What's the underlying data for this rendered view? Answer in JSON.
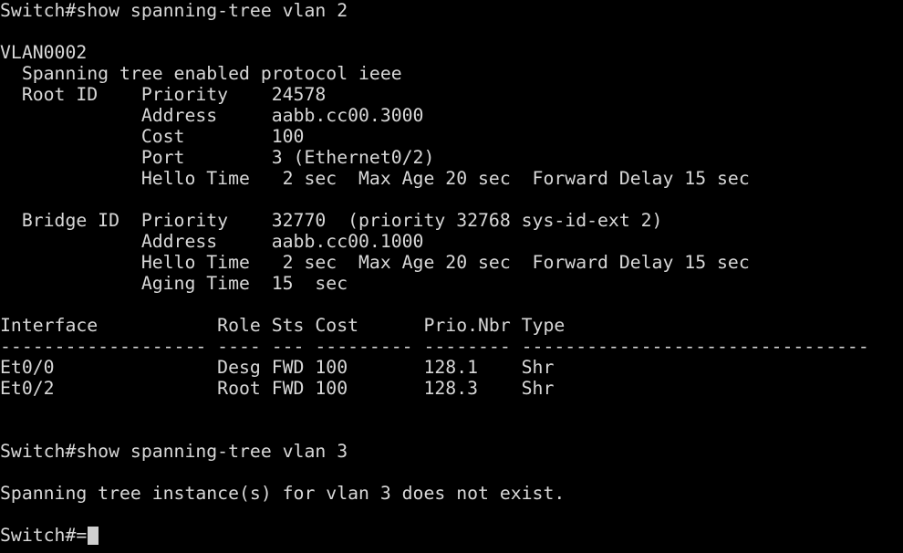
{
  "terminal": {
    "lines": [
      "Switch#show spanning-tree vlan 2",
      "",
      "VLAN0002",
      "  Spanning tree enabled protocol ieee",
      "  Root ID    Priority    24578",
      "             Address     aabb.cc00.3000",
      "             Cost        100",
      "             Port        3 (Ethernet0/2)",
      "             Hello Time   2 sec  Max Age 20 sec  Forward Delay 15 sec",
      "",
      "  Bridge ID  Priority    32770  (priority 32768 sys-id-ext 2)",
      "             Address     aabb.cc00.1000",
      "             Hello Time   2 sec  Max Age 20 sec  Forward Delay 15 sec",
      "             Aging Time  15  sec",
      "",
      "Interface           Role Sts Cost      Prio.Nbr Type",
      "------------------- ---- --- --------- -------- --------------------------------",
      "Et0/0               Desg FWD 100       128.1    Shr",
      "Et0/2               Root FWD 100       128.3    Shr",
      "",
      "",
      "Switch#show spanning-tree vlan 3",
      "",
      "Spanning tree instance(s) for vlan 3 does not exist.",
      ""
    ],
    "prompt": "Switch#="
  },
  "colors": {
    "background": "#000000",
    "foreground": "#d8d8d8",
    "cursor": "#cfcfcf"
  }
}
